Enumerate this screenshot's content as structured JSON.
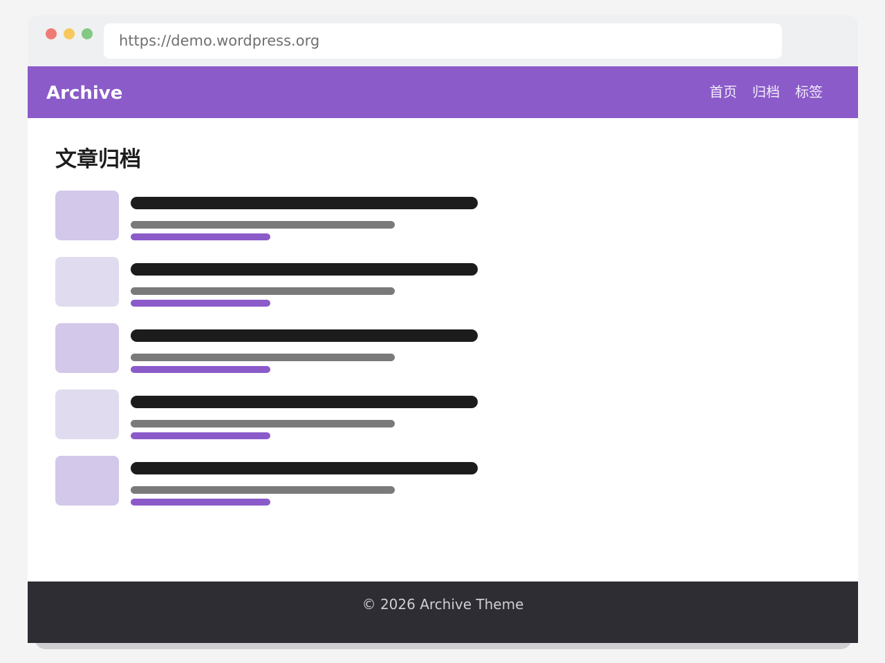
{
  "browser": {
    "url": "https://demo.wordpress.org",
    "window_controls": [
      "close",
      "minimize",
      "maximize"
    ]
  },
  "header": {
    "brand": "Archive",
    "nav": [
      {
        "label": "首页"
      },
      {
        "label": "归档"
      },
      {
        "label": "标签"
      }
    ]
  },
  "main": {
    "title": "文章归档",
    "posts": [
      {
        "thumb_color": "#d3c7ea"
      },
      {
        "thumb_color": "#e0dbef"
      },
      {
        "thumb_color": "#d3c7ea"
      },
      {
        "thumb_color": "#e0dbef"
      },
      {
        "thumb_color": "#d3c7ea"
      }
    ]
  },
  "footer": {
    "text": "© 2026 Archive Theme"
  },
  "colors": {
    "accent": "#8b5bc9",
    "footer_bg": "#2e2d33",
    "title_bar_placeholder": "#1c1c1c",
    "excerpt_placeholder": "#7a7a7a"
  }
}
